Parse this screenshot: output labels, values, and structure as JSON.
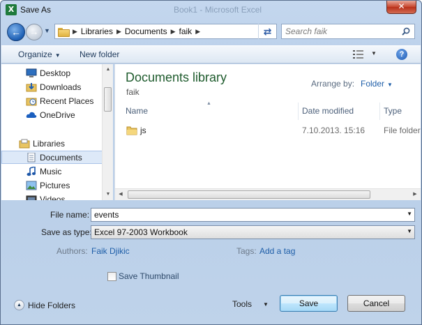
{
  "window": {
    "title": "Save As",
    "background_title": "Book1 - Microsoft Excel",
    "close_glyph": "✕"
  },
  "nav": {
    "breadcrumbs": [
      "Libraries",
      "Documents",
      "faik"
    ],
    "search_placeholder": "Search faik"
  },
  "toolbar": {
    "organize_label": "Organize",
    "new_folder_label": "New folder",
    "help_glyph": "?"
  },
  "sidebar": {
    "items": [
      {
        "label": "Desktop"
      },
      {
        "label": "Downloads"
      },
      {
        "label": "Recent Places"
      },
      {
        "label": "OneDrive"
      },
      {
        "label": "Libraries"
      },
      {
        "label": "Documents"
      },
      {
        "label": "Music"
      },
      {
        "label": "Pictures"
      },
      {
        "label": "Videos"
      }
    ]
  },
  "library": {
    "title": "Documents library",
    "subtitle": "faik",
    "arrange_label": "Arrange by:",
    "arrange_value": "Folder"
  },
  "columns": {
    "name": "Name",
    "date": "Date modified",
    "type": "Type"
  },
  "files": [
    {
      "name": "js",
      "date": "7.10.2013. 15:16",
      "type": "File folder"
    }
  ],
  "form": {
    "file_name_label": "File name:",
    "file_name_value": "events",
    "save_type_label": "Save as type:",
    "save_type_value": "Excel 97-2003 Workbook",
    "authors_label": "Authors:",
    "authors_value": "Faik Djikic",
    "tags_label": "Tags:",
    "tags_value": "Add a tag",
    "thumbnail_label": "Save Thumbnail"
  },
  "footer": {
    "hide_folders_label": "Hide Folders",
    "tools_label": "Tools",
    "save_label": "Save",
    "cancel_label": "Cancel"
  },
  "colors": {
    "library_title": "#1e5b2d",
    "link": "#1e5ea8",
    "close_button": "#c7452d"
  },
  "icons": [
    "excel-icon",
    "back-arrow-icon",
    "forward-arrow-icon",
    "folder-icon",
    "refresh-icon",
    "search-icon",
    "views-icon",
    "help-icon",
    "desktop-icon",
    "downloads-icon",
    "recent-places-icon",
    "onedrive-icon",
    "libraries-icon",
    "documents-icon",
    "music-icon",
    "pictures-icon",
    "videos-icon",
    "chevron-up-icon"
  ]
}
